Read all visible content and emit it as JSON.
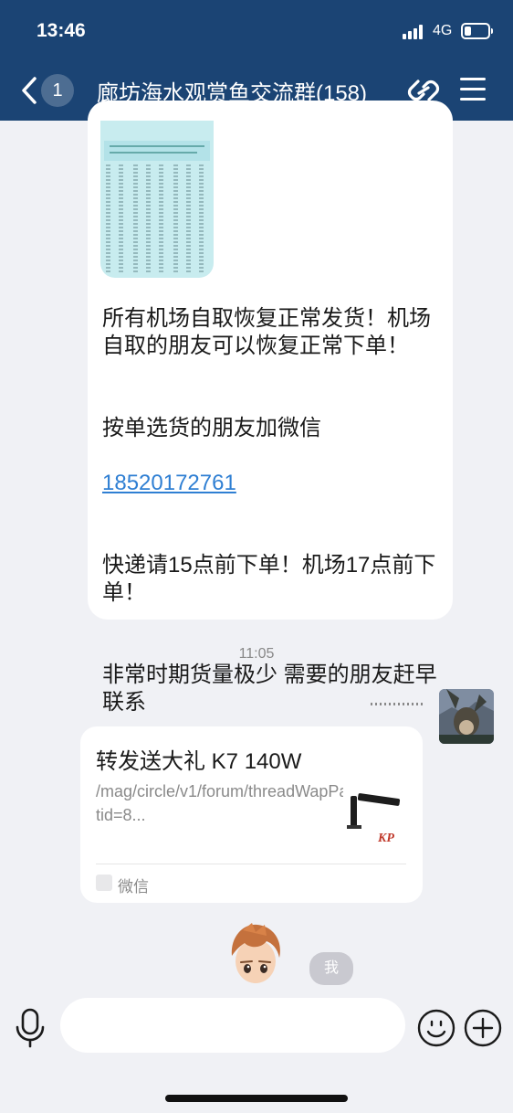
{
  "status_bar": {
    "time": "13:46",
    "network": "4G"
  },
  "nav": {
    "back_icon": "chevron-left-icon",
    "unread_count": "1",
    "title": "廊坊海水观赏鱼交流群(158)",
    "link_icon": "link-icon",
    "menu_icon": "menu-icon"
  },
  "message1": {
    "line1": "所有机场自取恢复正常发货！机场自取的朋友可以恢复正常下单！",
    "line2": "按单选货的朋友加微信",
    "phone": "18520172761",
    "line3": "快递请15点前下单！机场17点前下单！",
    "line4": "非常时期货量极少 需要的朋友赶早联系"
  },
  "timestamp": "11:05",
  "card": {
    "title": "转发送大礼 K7 140W",
    "desc": "/mag/circle/v1/forum/threadWapPage?tid=8...",
    "source": "微信"
  },
  "me_label": "我",
  "input": {
    "placeholder": "",
    "mic_icon": "microphone-icon",
    "emoji_icon": "smiley-icon",
    "plus_icon": "plus-circle-icon"
  },
  "colors": {
    "header_bg": "#1b4474",
    "link": "#2f7fd3",
    "background": "#f0f1f5"
  }
}
